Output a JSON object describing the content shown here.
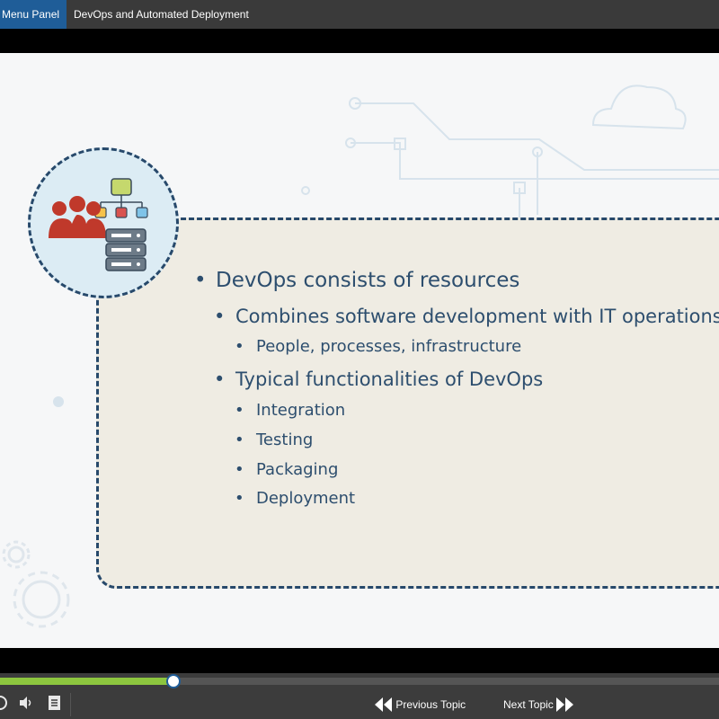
{
  "header": {
    "menu_panel_label": "e Menu Panel",
    "course_title": "DevOps and Automated Deployment"
  },
  "slide": {
    "bullets": [
      {
        "level": 1,
        "text": "DevOps consists of resources"
      },
      {
        "level": 2,
        "text": "Combines software development with IT operations"
      },
      {
        "level": 3,
        "text": "People, processes, infrastructure"
      },
      {
        "level": 2,
        "text": "Typical functionalities of DevOps"
      },
      {
        "level": 3,
        "text": "Integration"
      },
      {
        "level": 3,
        "text": "Testing"
      },
      {
        "level": 3,
        "text": "Packaging"
      },
      {
        "level": 3,
        "text": "Deployment"
      }
    ]
  },
  "player": {
    "progress_fraction": 0.24,
    "previous_label": "Previous Topic",
    "next_label": "Next Topic"
  },
  "colors": {
    "menu_button": "#1f5d98",
    "progress_fill": "#8dc63f",
    "text_dark_blue": "#2d4e6e",
    "panel_border": "#27496b"
  }
}
